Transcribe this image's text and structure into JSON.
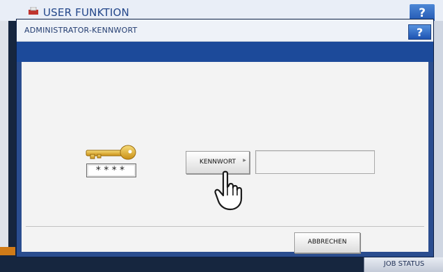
{
  "background_window": {
    "title": "USER FUNKTION",
    "help_label": "?",
    "job_status_label": "JOB STATUS"
  },
  "dialog": {
    "title": "ADMINISTRATOR-KENNWORT",
    "help_label": "?",
    "password_mask": "****",
    "kennwort_button_label": "KENNWORT",
    "password_value": "",
    "cancel_button_label": "ABBRECHEN"
  },
  "icons": [
    "printer-logo-icon",
    "key-icon",
    "pointing-hand-icon",
    "submenu-arrow-icon"
  ],
  "colors": {
    "dialog_frame": "#2a4d8f",
    "title_bar": "#eef2f8",
    "help_button": "#1e54b2",
    "body": "#f3f3f3",
    "key_gold": "#e6b328"
  }
}
